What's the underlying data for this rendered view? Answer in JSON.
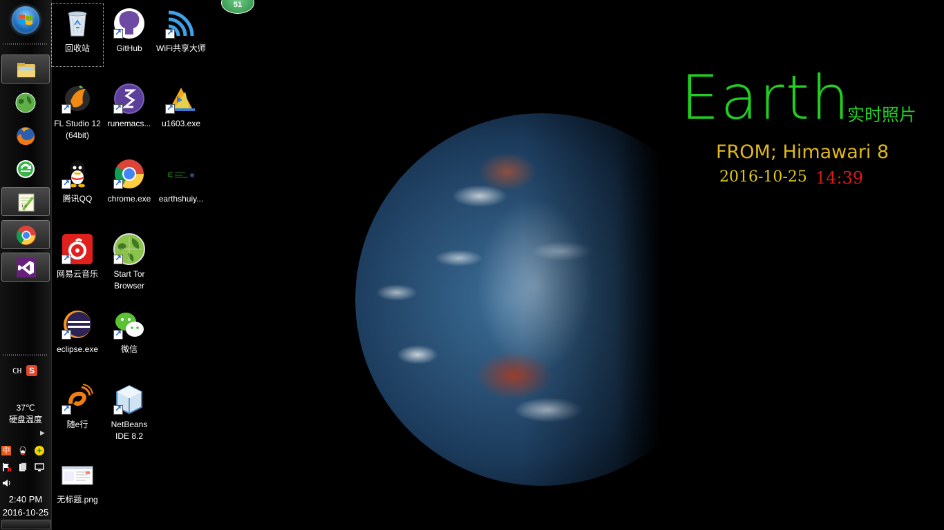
{
  "taskbar": {
    "pinned": [
      {
        "name": "explorer",
        "icon": "folder-icon",
        "active": true
      },
      {
        "name": "tor",
        "icon": "green-globe-icon",
        "active": false
      },
      {
        "name": "firefox",
        "icon": "firefox-icon",
        "active": false
      },
      {
        "name": "idm",
        "icon": "green-refresh-icon",
        "active": false
      },
      {
        "name": "notepad",
        "icon": "notepad-plus-icon",
        "active": true
      },
      {
        "name": "chrome",
        "icon": "chrome-icon",
        "active": true
      },
      {
        "name": "visual-studio",
        "icon": "visual-studio-icon",
        "active": true
      }
    ],
    "ime": "CH",
    "temperature": "37℃",
    "temperature_label": "硬盘温度",
    "time": "2:40 PM",
    "date": "2016-10-25"
  },
  "badge": "51",
  "desktop_icons": [
    {
      "label": "回收站",
      "icon": "recycle-bin-icon"
    },
    {
      "label": "GitHub",
      "icon": "github-icon"
    },
    {
      "label": "WiFi共享大师",
      "icon": "wifi-icon"
    },
    {
      "label": "FL Studio 12 (64bit)",
      "icon": "fl-studio-icon"
    },
    {
      "label": "runemacs...",
      "icon": "emacs-icon"
    },
    {
      "label": "u1603.exe",
      "icon": "u1603-icon"
    },
    {
      "label": "腾讯QQ",
      "icon": "qq-icon"
    },
    {
      "label": "chrome.exe",
      "icon": "chrome-icon"
    },
    {
      "label": "earthshuiy...",
      "icon": "earth-app-icon"
    },
    {
      "label": "网易云音乐",
      "icon": "netease-music-icon"
    },
    {
      "label": "Start Tor Browser",
      "icon": "tor-icon"
    },
    {
      "label": "eclipse.exe",
      "icon": "eclipse-icon"
    },
    {
      "label": "微信",
      "icon": "wechat-icon"
    },
    {
      "label": "随e行",
      "icon": "suiexing-icon"
    },
    {
      "label": "NetBeans IDE 8.2",
      "icon": "netbeans-icon"
    },
    {
      "label": "无标题.png",
      "icon": "png-file-icon"
    }
  ],
  "wallpaper": {
    "title": "Earth",
    "subtitle": "实时照片",
    "source": "FROM; Himawari 8",
    "date": "2016-10-25",
    "time": "14:39",
    "colors": {
      "title": "#20d020",
      "source": "#e0b818",
      "time": "#e01818"
    }
  }
}
